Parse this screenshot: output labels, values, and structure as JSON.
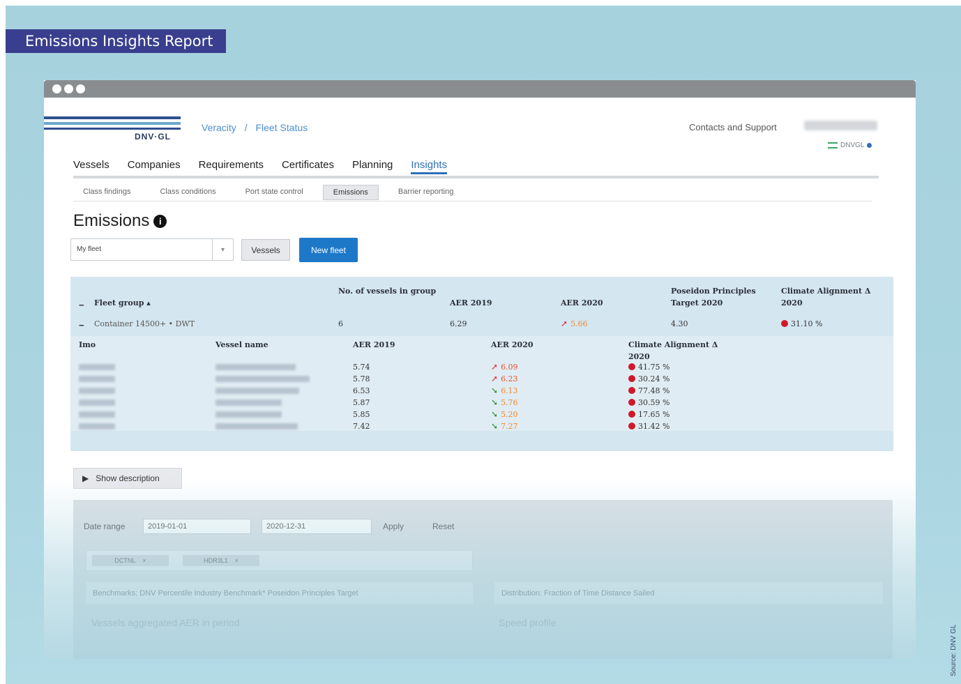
{
  "banner": {
    "title": "Emissions Insights Report"
  },
  "side_source": "Source: DNV GL",
  "header": {
    "logo_text": "DNV·GL",
    "breadcrumb": [
      "Veracity",
      "/",
      "Fleet Status"
    ],
    "contacts": "Contacts and Support",
    "env_label": "DNVGL"
  },
  "main_nav": [
    "Vessels",
    "Companies",
    "Requirements",
    "Certificates",
    "Planning",
    "Insights"
  ],
  "sub_nav": [
    "Class findings",
    "Class conditions",
    "Port state control",
    "Emissions",
    "Barrier reporting"
  ],
  "page": {
    "title": "Emissions",
    "info_icon": "i"
  },
  "controls": {
    "fleet_value": "My fleet",
    "caret": "▾",
    "vessels_button": "Vessels",
    "new_fleet_button": "New fleet"
  },
  "fleet_table": {
    "headers": {
      "fleet_group": "Fleet group ▴",
      "num_vessels": "No. of vessels in group",
      "aer2019": "AER 2019",
      "aer2020": "AER 2020",
      "pp_target": "Poseidon Principles Target 2020",
      "climate": "Climate Alignment Δ 2020"
    },
    "group_row": {
      "name": "Container 14500+ • DWT",
      "num": "6",
      "aer2019": "6.29",
      "aer2020": "5.66",
      "pp_target": "4.30",
      "climate": "31.10 %"
    },
    "detail_headers": {
      "imo": "Imo",
      "vessel_name": "Vessel name",
      "aer2019": "AER 2019",
      "aer2020": "AER 2020",
      "climate": "Climate Alignment Δ 2020"
    },
    "rows": [
      {
        "aer2019": "5.74",
        "aer2020": "6.09",
        "trend": "up",
        "climate": "41.75 %"
      },
      {
        "aer2019": "5.78",
        "aer2020": "6.23",
        "trend": "up",
        "climate": "30.24 %"
      },
      {
        "aer2019": "6.53",
        "aer2020": "6.13",
        "trend": "down",
        "climate": "77.48 %"
      },
      {
        "aer2019": "5.87",
        "aer2020": "5.76",
        "trend": "down",
        "climate": "30.59 %"
      },
      {
        "aer2019": "5.85",
        "aer2020": "5.20",
        "trend": "down",
        "climate": "17.65 %"
      },
      {
        "aer2019": "7.42",
        "aer2020": "7.27",
        "trend": "down",
        "climate": "31.42 %"
      }
    ]
  },
  "description_button": "Show description",
  "filters": {
    "date_range_label": "Date range",
    "date_from": "2019-01-01",
    "date_to": "2020-12-31",
    "apply": "Apply",
    "reset": "Reset",
    "chips": [
      "DCTNL",
      "HDR3L1"
    ],
    "benchmark_header": "Benchmarks: DNV Percentile Industry Benchmark* Poseidon Principles Target",
    "distribution_header": "Distribution: Fraction of Time Distance Sailed",
    "left_card_title": "Vessels aggregated AER in period",
    "right_card_title": "Speed profile"
  },
  "colors": {
    "banner": "#393f8e",
    "accent_blue": "#1e78c8",
    "table_bg": "#d4e6f0",
    "red_dot": "#d0182a",
    "orange": "#f28a2a"
  }
}
